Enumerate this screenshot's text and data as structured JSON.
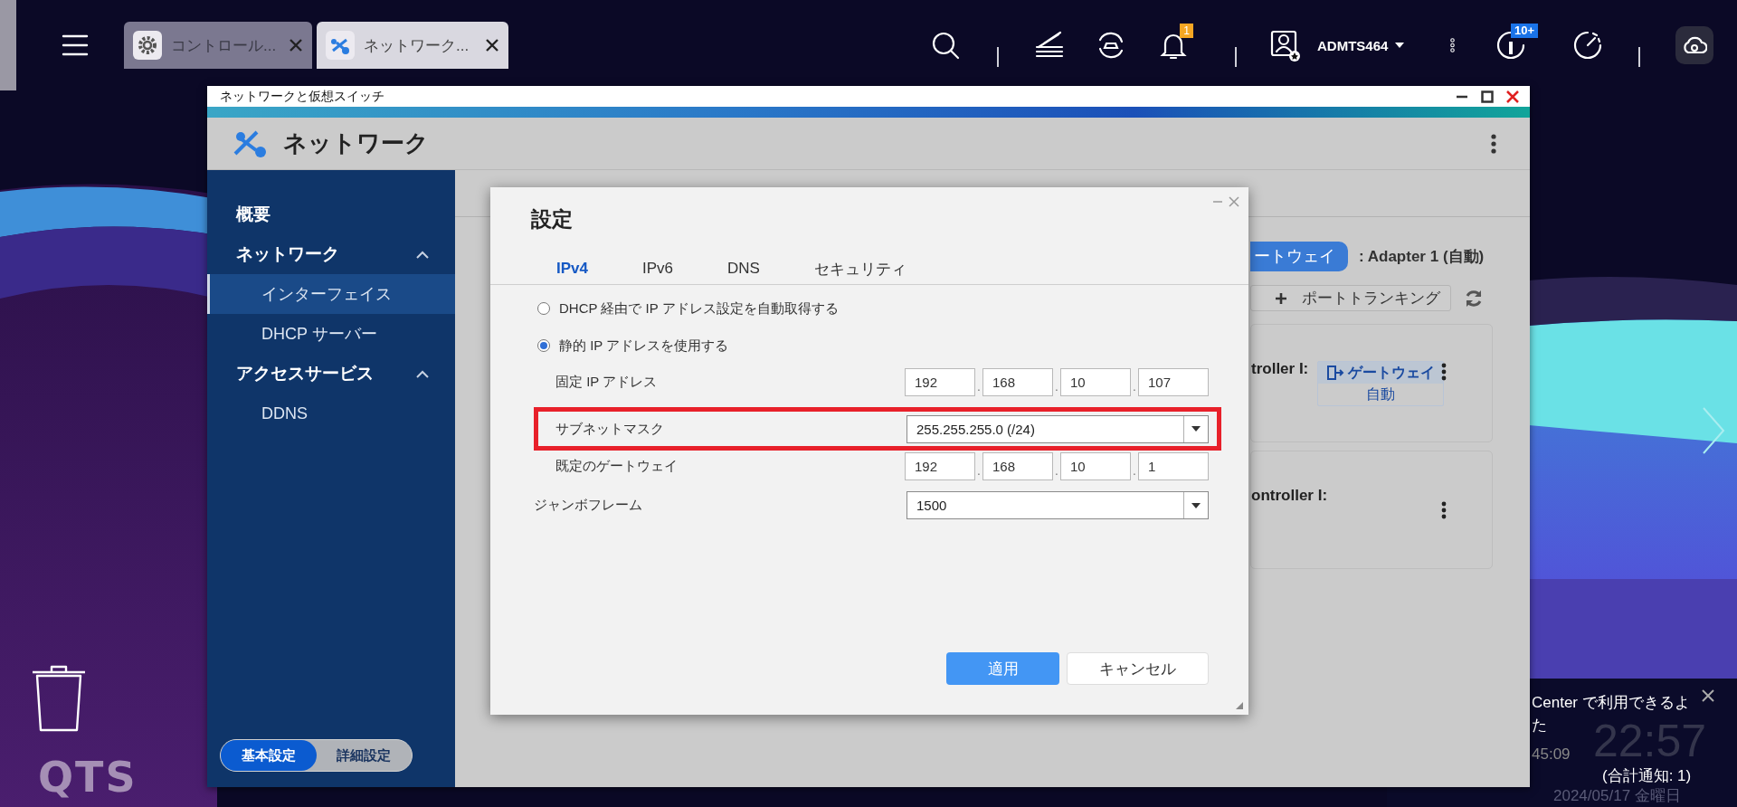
{
  "taskbar": {
    "tabs": [
      {
        "label": "コントロール...",
        "selected": false
      },
      {
        "label": "ネットワーク...",
        "selected": true
      }
    ],
    "notification_badge": "1",
    "user": "ADMTS464",
    "info_badge": "10+"
  },
  "desktop": {
    "logo": "QTS"
  },
  "window": {
    "title": "ネットワークと仮想スイッチ",
    "app_title": "ネットワーク",
    "sidebar": {
      "items": [
        {
          "label": "概要",
          "selected": false
        },
        {
          "label": "ネットワーク",
          "selected": false,
          "expanded": true,
          "children": [
            {
              "label": "インターフェイス",
              "selected": true
            },
            {
              "label": "DHCP サーバー",
              "selected": false
            }
          ]
        },
        {
          "label": "アクセスサービス",
          "selected": false,
          "expanded": true,
          "children": [
            {
              "label": "DDNS",
              "selected": false
            }
          ]
        }
      ]
    },
    "mode_toggle": [
      {
        "label": "基本設定",
        "selected": true
      },
      {
        "label": "詳細設定",
        "selected": false
      }
    ],
    "content": {
      "gateway_button": "ートウェイ",
      "adapter": ": Adapter 1 (自動)",
      "port_trunking": "ポートトランキング",
      "cards": [
        {
          "label": "troller I:",
          "gateway": "ゲートウェイ",
          "gateway_mode": "自動"
        },
        {
          "label": "ontroller I:"
        }
      ]
    }
  },
  "dialog": {
    "title": "設定",
    "tabs": [
      {
        "label": "IPv4",
        "selected": true
      },
      {
        "label": "IPv6",
        "selected": false
      },
      {
        "label": "DNS",
        "selected": false
      },
      {
        "label": "セキュリティ",
        "selected": false
      }
    ],
    "options": [
      {
        "label": "DHCP 経由で IP アドレス設定を自動取得する",
        "selected": false
      },
      {
        "label": "静的 IP アドレスを使用する",
        "selected": true,
        "fields": [
          {
            "kind": "ip",
            "label": "固定 IP アドレス",
            "octets": [
              "192",
              "168",
              "10",
              "107"
            ],
            "separator": ".",
            "highlighted": false
          },
          {
            "kind": "select",
            "label": "サブネットマスク",
            "value": "255.255.255.0 (/24)",
            "highlighted": true
          },
          {
            "kind": "ip",
            "label": "既定のゲートウェイ",
            "octets": [
              "192",
              "168",
              "10",
              "1"
            ],
            "separator": ".",
            "highlighted": false
          }
        ]
      }
    ],
    "jumbo_frame": {
      "kind": "select",
      "label": "ジャンボフレーム",
      "value": "1500"
    },
    "buttons": [
      {
        "label": "適用",
        "kind": "primary"
      },
      {
        "label": "キャンセル",
        "kind": "secondary"
      }
    ]
  },
  "notification": {
    "lines": [
      "Center で利用できるよ",
      "た"
    ],
    "time": "45:09",
    "clock": "22:57",
    "date": "2024/05/17 金曜日",
    "total": "(合計通知: 1)"
  }
}
